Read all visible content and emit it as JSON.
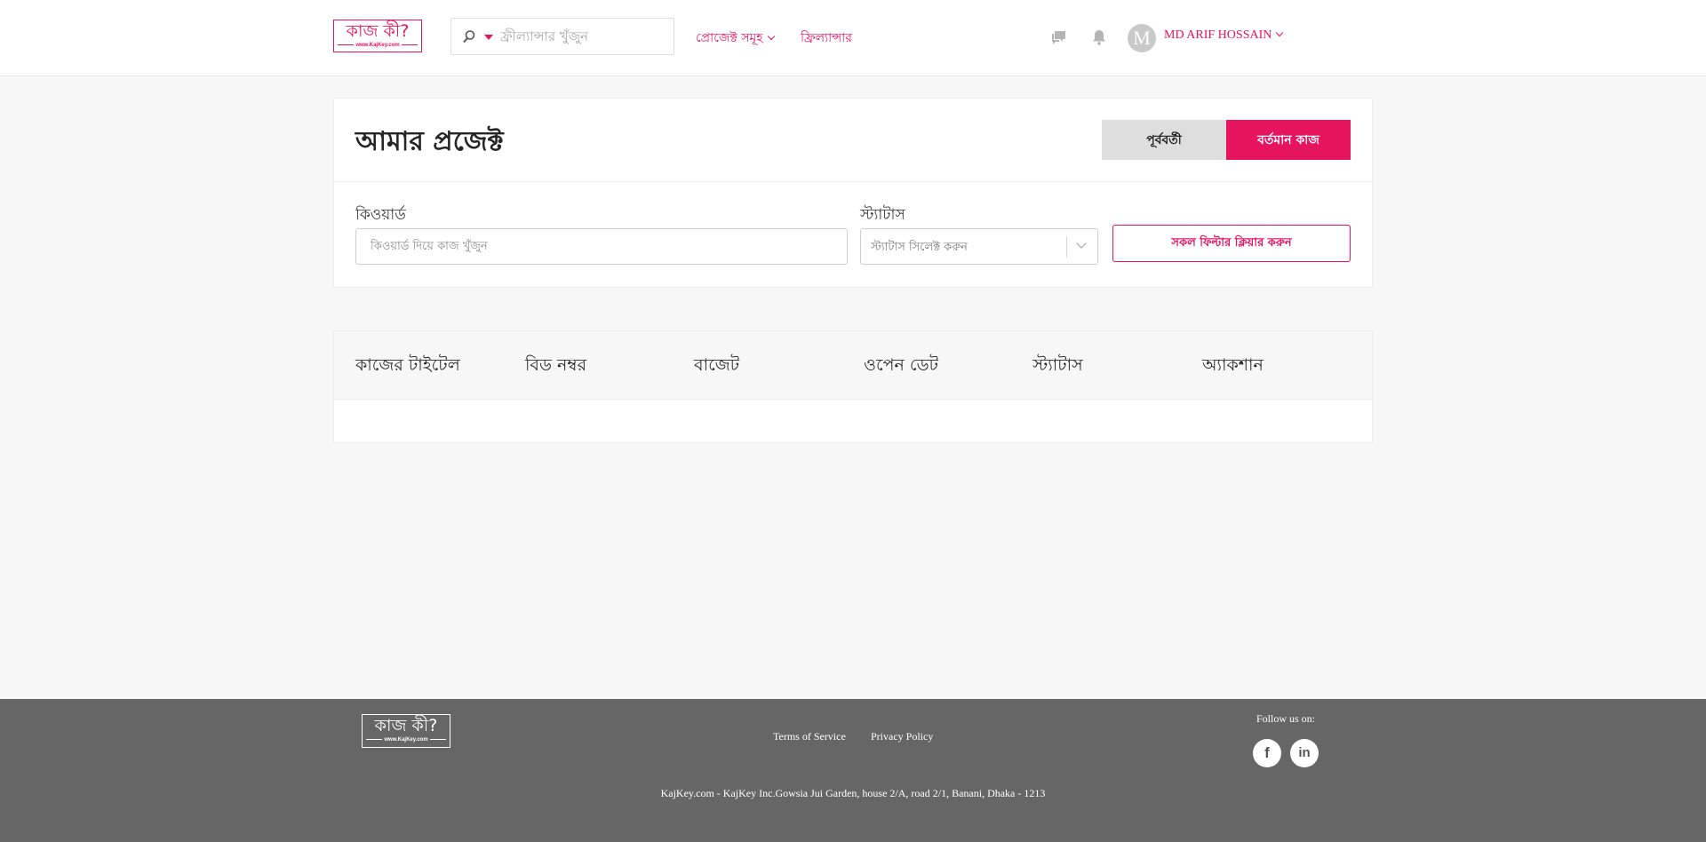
{
  "header": {
    "logo": {
      "main": "কাজ কী?",
      "url": "www.KajKey.com"
    },
    "search": {
      "placeholder": "ফ্রীল্যান্সার খুঁজুন"
    },
    "nav": {
      "projects": "প্রোজেক্ট সমূহ",
      "freelancer": "ফ্রিল্যান্সার"
    },
    "user": {
      "initial": "M",
      "name": "MD ARIF HOSSAIN"
    },
    "accent": "#e6135f"
  },
  "page": {
    "title": "আমার প্রজেক্ট",
    "toggle": {
      "previous": "পূর্ববর্তী",
      "current": "বর্তমান কাজ"
    },
    "filters": {
      "keyword_label": "কিওয়ার্ড",
      "keyword_placeholder": "কিওয়ার্ড দিয়ে কাজ খুঁজুন",
      "status_label": "স্ট্যাটাস",
      "status_placeholder": "স্ট্যাটাস সিলেক্ট করুন",
      "clear_button": "সকল ফিল্টার ক্লিয়ার করুন"
    },
    "table": {
      "columns": [
        "কাজের টাইটেল",
        "বিড নম্বর",
        "বাজেট",
        "ওপেন ডেট",
        "স্ট্যাটাস",
        "অ্যাকশান"
      ]
    }
  },
  "footer": {
    "logo": {
      "main": "কাজ কী?",
      "url": "www.KajKey.com"
    },
    "terms": "Terms of Service",
    "privacy": "Privacy Policy",
    "follow": "Follow us on:",
    "social": {
      "facebook": "f",
      "linkedin": "in"
    },
    "address": "KajKey.com - KajKey Inc.Gowsia Jui Garden, house 2/A, road 2/1, Banani, Dhaka - 1213"
  }
}
